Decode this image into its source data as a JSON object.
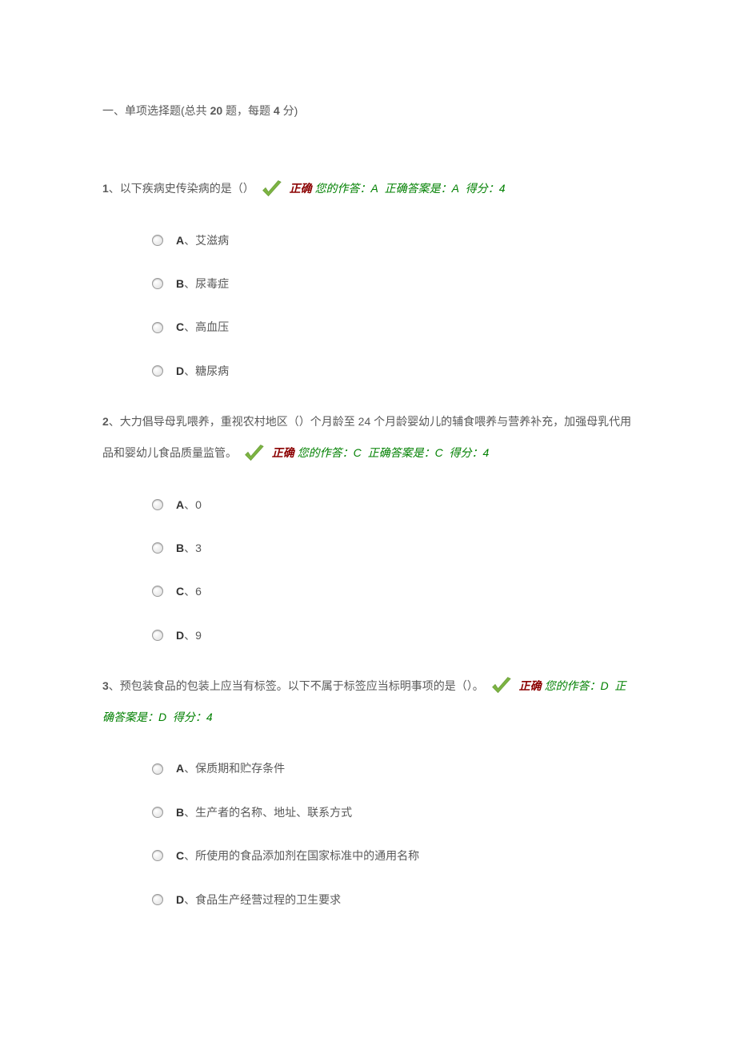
{
  "section_header": {
    "prefix": "一、单项选择题(总共 ",
    "total_bold": "20",
    "mid": " 题，每题 ",
    "points_bold": "4",
    "suffix": " 分)"
  },
  "result_labels": {
    "correct": "正确",
    "your_answer_prefix": "您的作答：",
    "correct_answer_prefix": "正确答案是：",
    "score_prefix": "得分：",
    "score_value": "4"
  },
  "questions": [
    {
      "number": "1",
      "text": "、以下疾病史传染病的是（）",
      "your_answer": "A",
      "correct_answer": "A",
      "options": [
        {
          "letter": "A",
          "text": "、艾滋病"
        },
        {
          "letter": "B",
          "text": "、尿毒症"
        },
        {
          "letter": "C",
          "text": "、高血压"
        },
        {
          "letter": "D",
          "text": "、糖尿病"
        }
      ]
    },
    {
      "number": "2",
      "text_pre": "、大力倡导母乳喂养，重视农村地区（）个月龄至 24 个月龄婴幼儿的辅食喂养与营养补充，加强母乳代用品和婴幼儿食品质量监管。",
      "your_answer": "C",
      "correct_answer": "C",
      "options": [
        {
          "letter": "A",
          "text": "、0"
        },
        {
          "letter": "B",
          "text": "、3"
        },
        {
          "letter": "C",
          "text": "、6"
        },
        {
          "letter": "D",
          "text": "、9"
        }
      ]
    },
    {
      "number": "3",
      "text": "、预包装食品的包装上应当有标签。以下不属于标签应当标明事项的是（）。",
      "your_answer": "D",
      "correct_answer": "D",
      "options": [
        {
          "letter": "A",
          "text": "、保质期和贮存条件"
        },
        {
          "letter": "B",
          "text": "、生产者的名称、地址、联系方式"
        },
        {
          "letter": "C",
          "text": "、所使用的食品添加剂在国家标准中的通用名称"
        },
        {
          "letter": "D",
          "text": "、食品生产经营过程的卫生要求"
        }
      ]
    }
  ]
}
